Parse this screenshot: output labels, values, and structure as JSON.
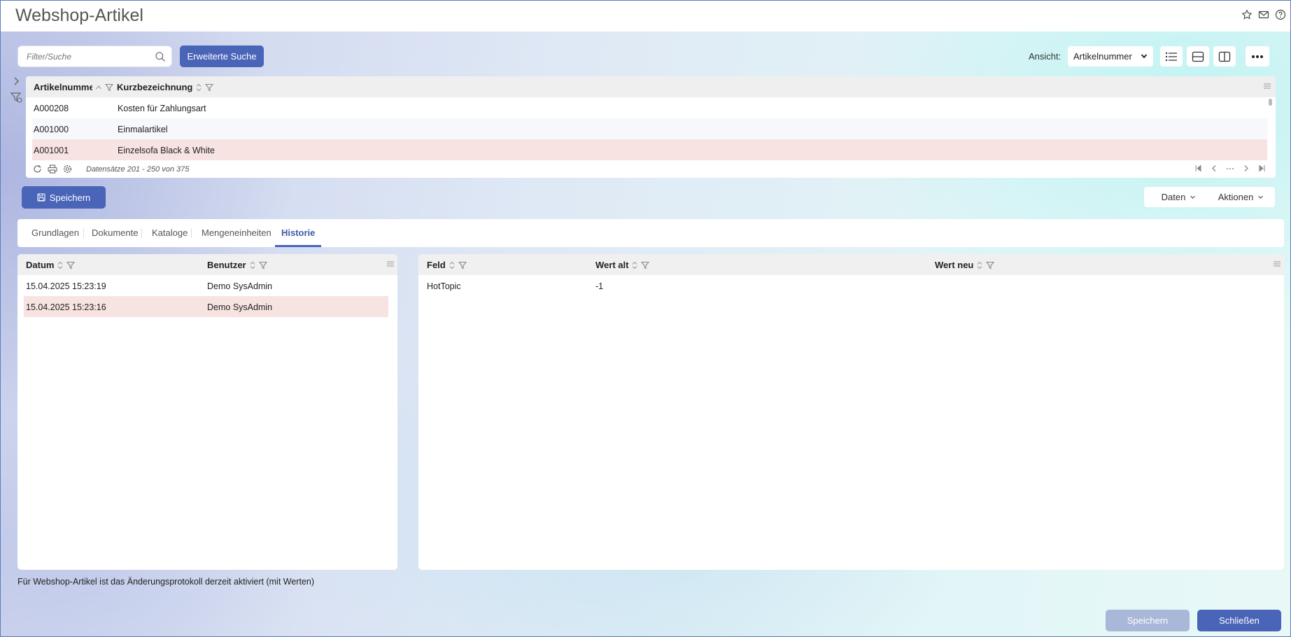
{
  "window": {
    "title": "Webshop-Artikel"
  },
  "toolbar": {
    "search_placeholder": "Filter/Suche",
    "extended_search_label": "Erweiterte Suche",
    "view_label": "Ansicht:",
    "view_value": "Artikelnummer"
  },
  "article_grid": {
    "columns": [
      "Artikelnummer",
      "Kurzbezeichnung"
    ],
    "rows": [
      {
        "artikelnummer": "A000208",
        "kurzbezeichnung": "Kosten für Zahlungsart"
      },
      {
        "artikelnummer": "A001000",
        "kurzbezeichnung": "Einmalartikel"
      },
      {
        "artikelnummer": "A001001",
        "kurzbezeichnung": "Einzelsofa Black & White"
      }
    ],
    "selected_row": 2,
    "records_text": "Datensätze 201 - 250 von 375"
  },
  "actions": {
    "save_label": "Speichern",
    "daten_label": "Daten",
    "aktionen_label": "Aktionen"
  },
  "tabs": [
    {
      "label": "Grundlagen"
    },
    {
      "label": "Dokumente"
    },
    {
      "label": "Kataloge"
    },
    {
      "label": "Mengeneinheiten"
    },
    {
      "label": "Historie"
    }
  ],
  "active_tab": "Historie",
  "history_grid": {
    "columns": [
      "Datum",
      "Benutzer"
    ],
    "rows": [
      {
        "datum": "15.04.2025 15:23:19",
        "benutzer": "Demo SysAdmin"
      },
      {
        "datum": "15.04.2025 15:23:16",
        "benutzer": "Demo SysAdmin"
      }
    ]
  },
  "changes_grid": {
    "columns": [
      "Feld",
      "Wert alt",
      "Wert neu"
    ],
    "rows": [
      {
        "feld": "HotTopic",
        "wert_alt": "-1",
        "wert_neu": ""
      }
    ]
  },
  "footnote": "Für Webshop-Artikel ist das Änderungsprotokoll derzeit aktiviert (mit Werten)",
  "footer": {
    "save_label": "Speichern",
    "close_label": "Schließen"
  },
  "colors": {
    "primary": "#4a64b8",
    "primary_disabled": "#a9b7d9",
    "selected_row": "#f7e3e1"
  }
}
